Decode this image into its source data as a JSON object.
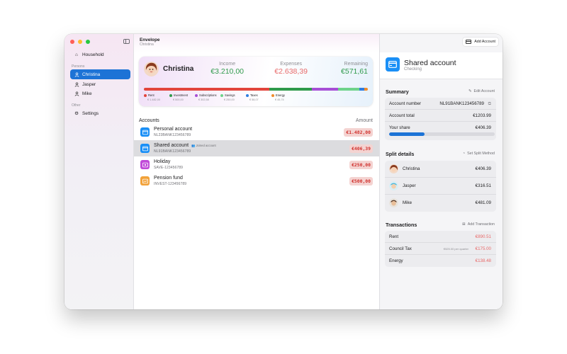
{
  "app": {
    "title": "Envelope",
    "subtitle": "Christina"
  },
  "sidebar": {
    "household": "Household",
    "persons_label": "Persons",
    "persons": [
      "Christina",
      "Jasper",
      "Mike"
    ],
    "other_label": "Other",
    "settings": "Settings"
  },
  "summary": {
    "name": "Christina",
    "income_label": "Income",
    "income": "€3.210,00",
    "expenses_label": "Expenses",
    "expenses": "€2.638,39",
    "remaining_label": "Remaining",
    "remaining": "€571,61",
    "categories": [
      {
        "name": "Rent",
        "amount": "€ 1.482,00",
        "color": "#e2453c",
        "share": 0.562
      },
      {
        "name": "Investment",
        "amount": "€ 500,00",
        "color": "#2f9a4b",
        "share": 0.19
      },
      {
        "name": "Subscriptions",
        "amount": "€ 302,58",
        "color": "#a64fd6",
        "share": 0.115
      },
      {
        "name": "Savings",
        "amount": "€ 250,00",
        "color": "#6dd38a",
        "share": 0.095
      },
      {
        "name": "Taxes",
        "amount": "€ 58,07",
        "color": "#2f7ee0",
        "share": 0.022
      },
      {
        "name": "Energy",
        "amount": "€ 45,74",
        "color": "#f08c2c",
        "share": 0.017
      }
    ]
  },
  "accounts": {
    "header": "Accounts",
    "amount_header": "Amount",
    "items": [
      {
        "name": "Personal account",
        "number": "NL23BANK123456789",
        "amount": "€1.482,00",
        "tag": "",
        "color": "#1a8ff6"
      },
      {
        "name": "Shared account",
        "number": "NL91BANK123456789",
        "amount": "€406,39",
        "tag": "Joined account",
        "color": "#1a8ff6"
      },
      {
        "name": "Holiday",
        "number": "SAVE-123456789",
        "amount": "€250,00",
        "tag": "",
        "color": "#c04ad8"
      },
      {
        "name": "Pension fund",
        "number": "INVEST-123456789",
        "amount": "€500,00",
        "tag": "",
        "color": "#f2a23a"
      }
    ]
  },
  "detail": {
    "add_account": "Add Account",
    "title": "Shared account",
    "subtitle": "Checking",
    "summary_label": "Summary",
    "edit_account": "Edit Account",
    "account_number_label": "Account number",
    "account_number": "NL91BANK123456789",
    "account_total_label": "Account total",
    "account_total": "€1203.99",
    "your_share_label": "Your share",
    "your_share": "€406.39",
    "share_fraction": 0.338,
    "split_label": "Split details",
    "set_split": "Set Split Method",
    "split": [
      {
        "name": "Christina",
        "value": "€406.39"
      },
      {
        "name": "Jasper",
        "value": "€316.51"
      },
      {
        "name": "Mike",
        "value": "€481.09"
      }
    ],
    "transactions_label": "Transactions",
    "add_transaction": "Add Transaction",
    "transactions": [
      {
        "name": "Rent",
        "value": "€890.51",
        "note": ""
      },
      {
        "name": "Council Tax",
        "value": "€175.00",
        "note": "€525.00 per quarter"
      },
      {
        "name": "Energy",
        "value": "€138.48",
        "note": ""
      }
    ]
  }
}
